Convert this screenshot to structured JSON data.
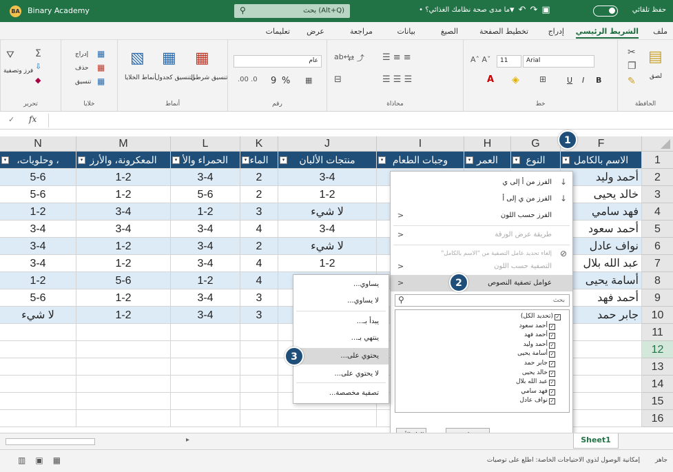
{
  "titlebar": {
    "logo": "BA",
    "app_name": "Binary Academy",
    "search_text": "بحث (Alt+Q)",
    "doc_title": "ما مدى صحة نظامك الغذائي؟ •",
    "autosave": "حفظ تلقائي"
  },
  "tabs": [
    "ملف",
    "الشريط الرئيسي",
    "إدراج",
    "تخطيط الصفحة",
    "الصيغ",
    "بيانات",
    "مراجعة",
    "عرض",
    "تعليمات"
  ],
  "ribbon": {
    "clipboard": {
      "label": "الحافظة",
      "paste": "لصق"
    },
    "font": {
      "label": "خط",
      "name": "Arial",
      "size": "11",
      "bold": "B",
      "italic": "I",
      "underline": "U"
    },
    "alignment": {
      "label": "محاذاة"
    },
    "number": {
      "label": "رقم",
      "format": "عام",
      "percent": "%",
      "comma": "9"
    },
    "styles": {
      "label": "أنماط",
      "conditional": "تنسيق شرطي",
      "table": "التنسيق كجدول",
      "cell": "أنماط الخلايا"
    },
    "cells": {
      "label": "خلايا",
      "insert": "إدراج",
      "delete": "حذف",
      "format": "تنسيق"
    },
    "editing": {
      "label": "تحرير",
      "sort": "فرز وتصفية"
    }
  },
  "formula": {
    "fx": "fx"
  },
  "columns": [
    "N",
    "M",
    "L",
    "K",
    "J",
    "I",
    "H",
    "G",
    "F"
  ],
  "rows": [
    "1",
    "2",
    "3",
    "4",
    "5",
    "6",
    "7",
    "8",
    "9",
    "10",
    "11",
    "12",
    "13",
    "14",
    "15",
    "16"
  ],
  "headers": [
    "، وحلويات،",
    "المعكرونة، والأرز",
    "الحمراء والأ",
    "الماء",
    "منتجات الألبان",
    "وجبات الطعام",
    "العمر",
    "النوع",
    "الاسم بالكامل"
  ],
  "table": [
    [
      "5-6",
      "1-2",
      "3-4",
      "2",
      "3-4",
      "أحمد وليد"
    ],
    [
      "5-6",
      "1-2",
      "5-6",
      "2",
      "1-2",
      "خالد يحيى"
    ],
    [
      "1-2",
      "3-4",
      "1-2",
      "3",
      "لا شيء",
      "فهد سامي"
    ],
    [
      "3-4",
      "3-4",
      "3-4",
      "4",
      "3-4",
      "أحمد سعود"
    ],
    [
      "3-4",
      "1-2",
      "3-4",
      "2",
      "لا شيء",
      "نواف عادل"
    ],
    [
      "3-4",
      "1-2",
      "3-4",
      "4",
      "1-2",
      "عبد الله بلال"
    ],
    [
      "1-2",
      "5-6",
      "1-2",
      "4",
      "",
      "أسامة يحيى"
    ],
    [
      "5-6",
      "1-2",
      "3-4",
      "3",
      "",
      "أحمد فهد"
    ],
    [
      "لا شيء",
      "1-2",
      "3-4",
      "3",
      "",
      "جابر حمد"
    ]
  ],
  "filter_panel": {
    "items": [
      {
        "label": "الفرز من أ إلى ي",
        "icon": "↓",
        "arrow": ""
      },
      {
        "label": "الفرز من ي إلى أ",
        "icon": "↓",
        "arrow": ""
      },
      {
        "label": "الفرز حسب اللون",
        "icon": "",
        "arrow": "<"
      },
      {
        "label": "طريقة عرض الورقة",
        "icon": "",
        "arrow": "<"
      },
      {
        "label": "إلغاء تحديد عامل التصفية من \"الاسم بالكامل\"",
        "icon": "⊘",
        "arrow": ""
      },
      {
        "label": "التصفية حسب اللون",
        "icon": "",
        "arrow": "<"
      },
      {
        "label": "عوامل تصفية النصوص",
        "icon": "",
        "arrow": "<"
      }
    ],
    "search_placeholder": "بحث",
    "list": [
      "(تحديد الكل)",
      "أحمد سعود",
      "أحمد فهد",
      "أحمد وليد",
      "أسامة يحيى",
      "جابر حمد",
      "خالد يحيى",
      "عبد الله بلال",
      "فهد سامي",
      "نواف عادل"
    ],
    "ok": "موافق",
    "cancel": "إلغاء الأمر"
  },
  "submenu": [
    "يساوي...",
    "لا يساوي...",
    "يبدأ بـ...",
    "ينتهي بـ...",
    "يحتوي على...",
    "لا يحتوي على...",
    "تصفية مخصصة..."
  ],
  "sheet": {
    "tab": "Sheet1"
  },
  "status": {
    "ready": "جاهز",
    "accessibility": "إمكانية الوصول لذوي الاحتياجات الخاصة: اطلع على توصيات"
  },
  "badges": [
    "1",
    "2",
    "3"
  ],
  "colors": {
    "excel_green": "#217346",
    "header_blue": "#1f4e79",
    "band_blue": "#ddebf7"
  }
}
